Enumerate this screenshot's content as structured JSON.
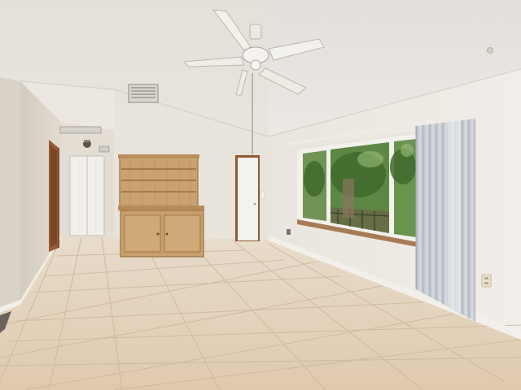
{
  "scene": {
    "kind": "photo",
    "subject": "empty-room-interior"
  },
  "colors": {
    "ceiling": "#e9e6e0",
    "wall_left": "#ddd7cd",
    "wall_back": "#ebe7df",
    "wall_right": "#eeeae4",
    "floor_tile": "#e3cfb8",
    "floor_grout": "#c9b49a",
    "hutch_wood": "#c9a270",
    "hutch_wood_dark": "#a77f4f",
    "door": "#f2f0ec",
    "door_frame": "#9a6a3c",
    "curtain": "#cfd3d8",
    "window_frame": "#f4f2ee",
    "foliage": "#4f7a3b",
    "baseboard": "#f2efea"
  },
  "icons": [
    "ceiling-fan-icon",
    "air-vent-icon",
    "light-fixture-icon",
    "electrical-outlet-icon"
  ]
}
